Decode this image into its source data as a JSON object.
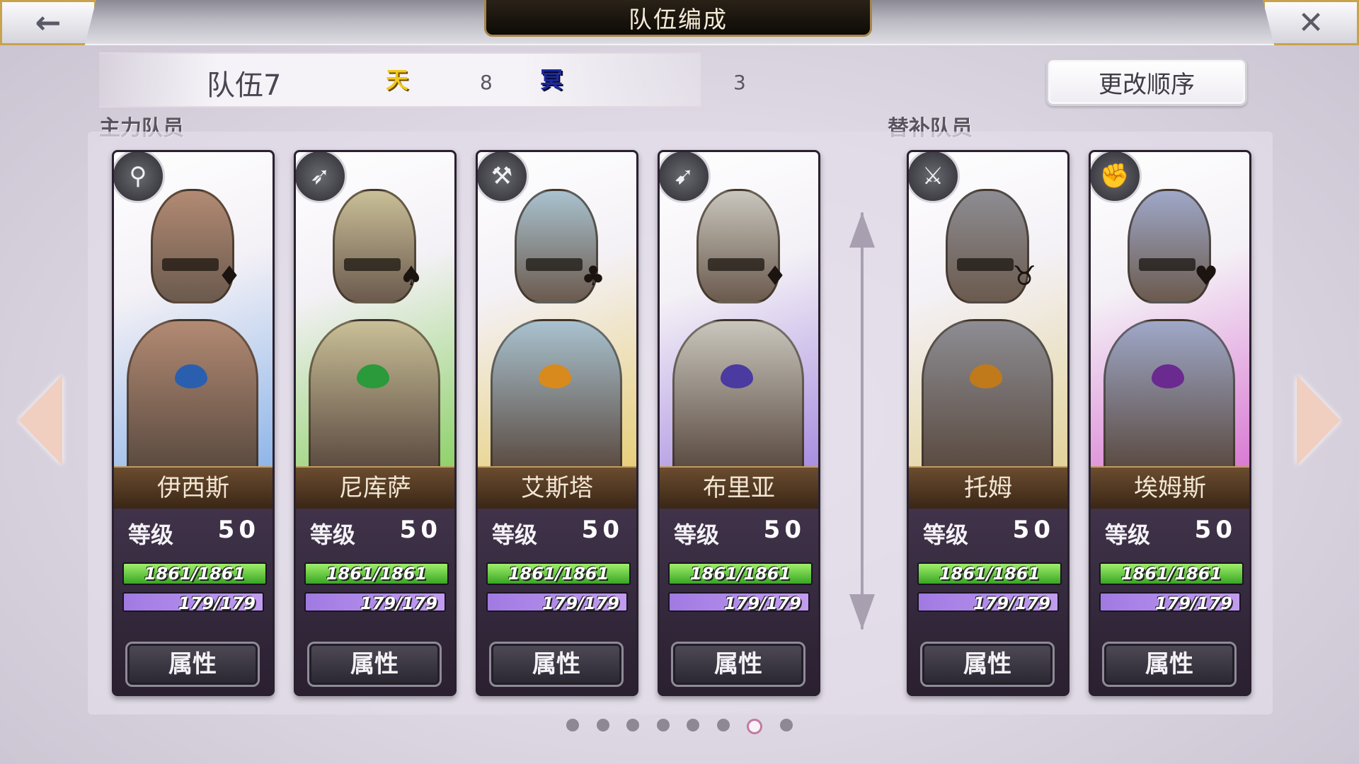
{
  "header": {
    "title": "队伍编成",
    "back_icon": "←",
    "close_icon": "✕"
  },
  "team": {
    "name": "队伍7",
    "heaven_icon": "天",
    "heaven_count": "8",
    "nether_icon": "冥",
    "nether_count": "3"
  },
  "order_button": "更改顺序",
  "sections": {
    "main": "主力队员",
    "sub": "替补队员"
  },
  "common": {
    "level_label": "等级",
    "attr_button": "属性"
  },
  "members": [
    {
      "name": "伊西斯",
      "level": "50",
      "hp": "1861/1861",
      "mp": "179/179",
      "weapon": "staff",
      "weapon_glyph": "⚲",
      "symbol": "♦",
      "colors": {
        "armor": "#b28a73",
        "bg": "#8fb6e8",
        "gem": "#2a5fb0"
      }
    },
    {
      "name": "尼库萨",
      "level": "50",
      "hp": "1861/1861",
      "mp": "179/179",
      "weapon": "bow",
      "weapon_glyph": "➶",
      "symbol": "♠",
      "colors": {
        "armor": "#c9bf97",
        "bg": "#8fd26b",
        "gem": "#2a9a3a"
      }
    },
    {
      "name": "艾斯塔",
      "level": "50",
      "hp": "1861/1861",
      "mp": "179/179",
      "weapon": "axe",
      "weapon_glyph": "⚒",
      "symbol": "♣",
      "colors": {
        "armor": "#a9c2cf",
        "bg": "#e7cf7a",
        "gem": "#d88a1c"
      }
    },
    {
      "name": "布里亚",
      "level": "50",
      "hp": "1861/1861",
      "mp": "179/179",
      "weapon": "spear",
      "weapon_glyph": "➹",
      "symbol": "♦",
      "colors": {
        "armor": "#c9c6bd",
        "bg": "#a88ee0",
        "gem": "#4b3aa0"
      }
    },
    {
      "name": "托姆",
      "level": "50",
      "hp": "1861/1861",
      "mp": "179/179",
      "weapon": "sword",
      "weapon_glyph": "⚔",
      "symbol": "♉",
      "colors": {
        "armor": "#8d8d93",
        "bg": "#e3d39a",
        "gem": "#c07a1c"
      }
    },
    {
      "name": "埃姆斯",
      "level": "50",
      "hp": "1861/1861",
      "mp": "179/179",
      "weapon": "fist",
      "weapon_glyph": "✊",
      "symbol": "♥",
      "colors": {
        "armor": "#9fa8c8",
        "bg": "#d97ad3",
        "gem": "#6a2a90"
      }
    }
  ],
  "pagination": {
    "total": 8,
    "current": 7
  }
}
